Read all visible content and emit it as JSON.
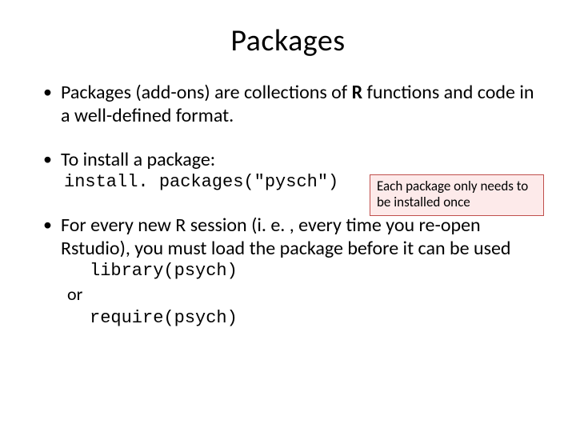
{
  "title": "Packages",
  "bullets": {
    "b1_part1": "Packages (add-ons) are collections of ",
    "b1_bold": "R",
    "b1_part2": " functions and code in a well-defined format.",
    "b2": "To install a package:",
    "b2_code": "install. packages(\"pysch\")",
    "b3": "For every new R session (i. e. , every time you re-open Rstudio), you must load the package before it can be used",
    "b3_code1": "library(psych)",
    "b3_or": "or",
    "b3_code2": "require(psych)"
  },
  "note": {
    "line1": "Each package only needs to",
    "line2": "be installed once"
  }
}
